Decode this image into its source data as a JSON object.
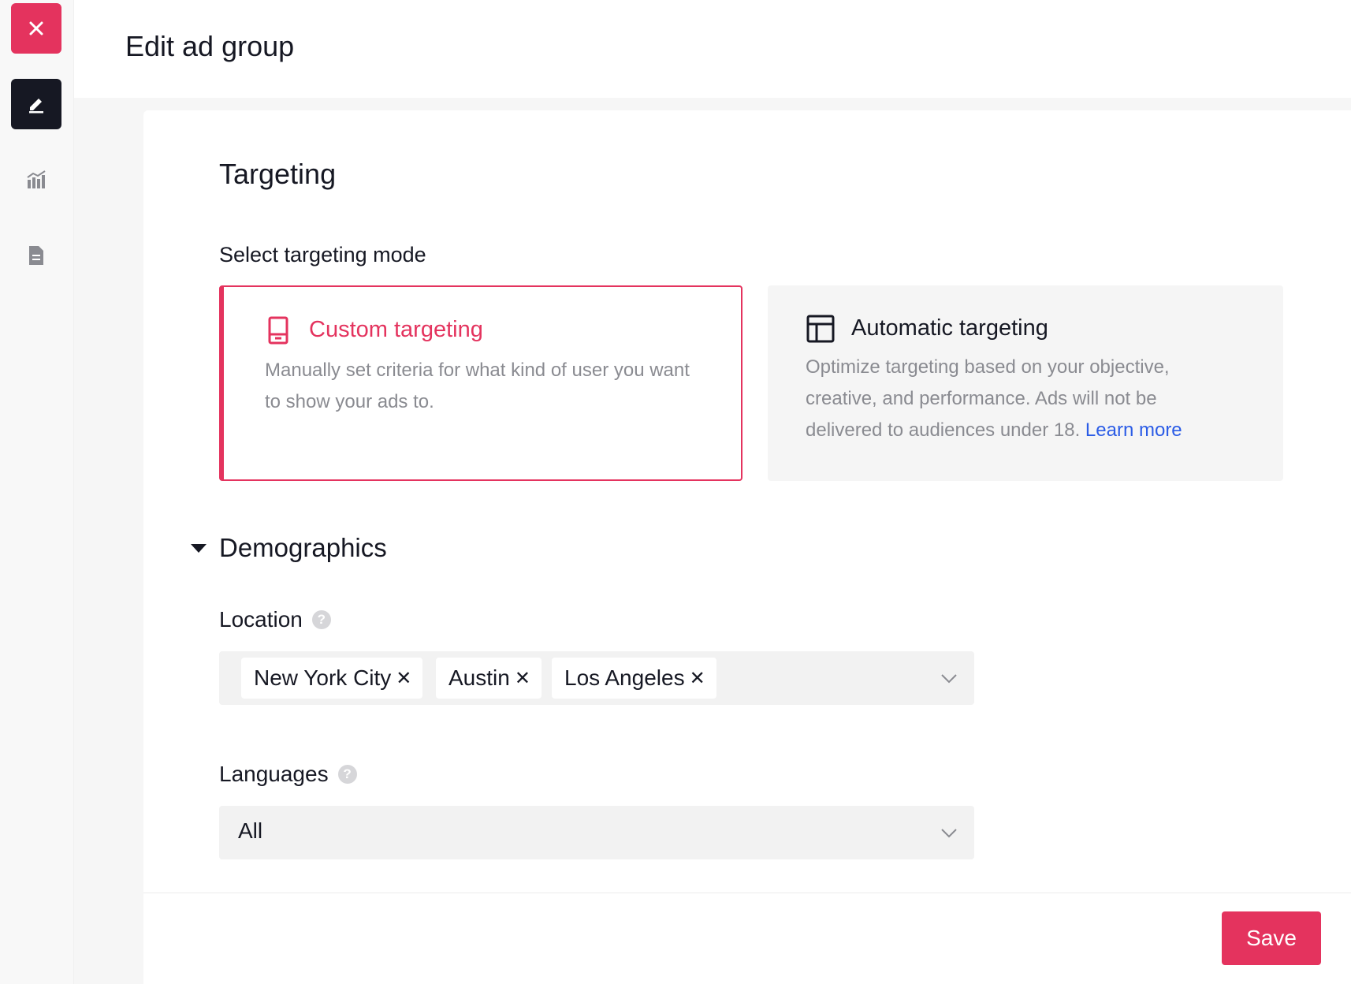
{
  "header": {
    "title": "Edit ad group"
  },
  "rail": {
    "items": [
      {
        "icon": "close-icon",
        "color": "#e4335e"
      },
      {
        "icon": "edit-icon",
        "color": "#161823"
      },
      {
        "icon": "analytics-icon"
      },
      {
        "icon": "document-icon"
      }
    ]
  },
  "targeting": {
    "title": "Targeting",
    "mode_label": "Select targeting mode",
    "custom": {
      "title": "Custom targeting",
      "description": "Manually set criteria for what kind of user you want to show your ads to.",
      "selected": true
    },
    "automatic": {
      "title": "Automatic targeting",
      "description": "Optimize targeting based on your objective, creative, and performance. Ads will not be delivered to audiences under 18.",
      "link": "Learn more"
    }
  },
  "demographics": {
    "title": "Demographics",
    "location": {
      "label": "Location",
      "tags": [
        "New York City",
        "Austin",
        "Los Angeles"
      ]
    },
    "languages": {
      "label": "Languages",
      "value": "All"
    }
  },
  "footer": {
    "save_label": "Save"
  },
  "colors": {
    "accent": "#e4335e",
    "link": "#2b5ce6",
    "text": "#161823",
    "muted": "#8a8b91"
  }
}
